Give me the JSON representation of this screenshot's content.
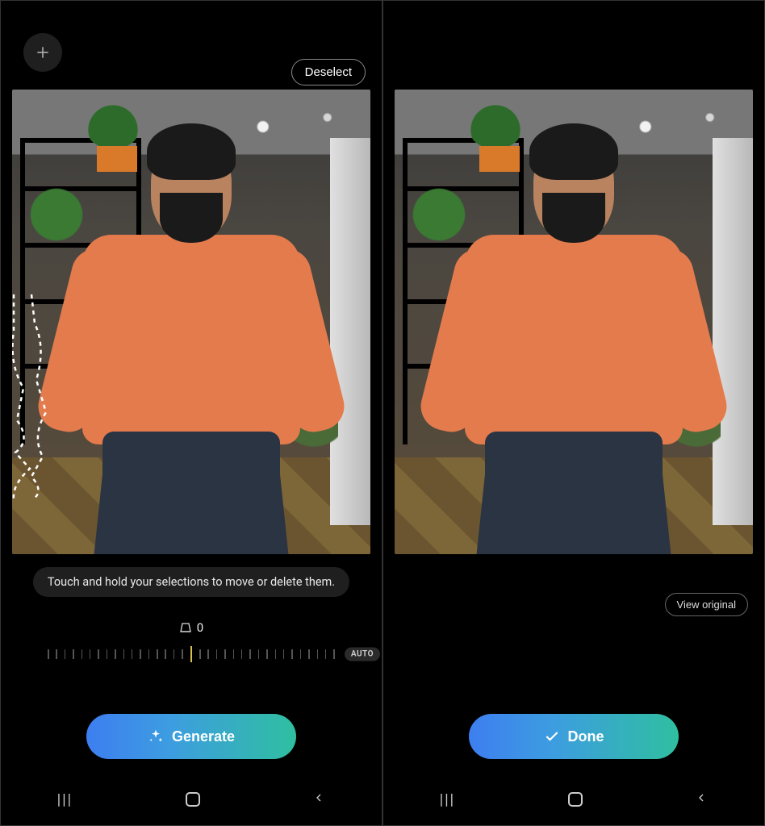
{
  "left": {
    "deselect_label": "Deselect",
    "hint_text": "Touch and hold your selections to move or delete them.",
    "slider": {
      "value_label": "0",
      "auto_label": "AUTO",
      "icon": "perspective-icon"
    },
    "primary_btn_label": "Generate",
    "selection_present": true
  },
  "right": {
    "view_original_label": "View original",
    "primary_btn_label": "Done"
  },
  "nav": {
    "recents_glyph": "|||",
    "icons": {
      "home": "home-icon",
      "back": "back-icon"
    }
  },
  "icons": {
    "add": "plus-icon",
    "sparkle": "sparkle-icon",
    "check": "check-icon",
    "perspective": "perspective-icon"
  }
}
